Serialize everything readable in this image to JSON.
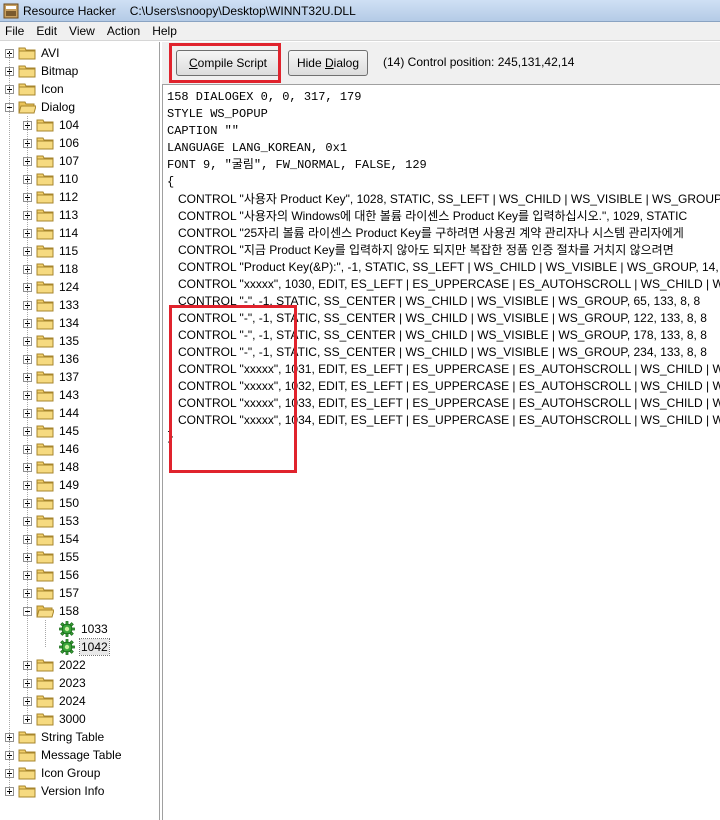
{
  "window": {
    "app_name": "Resource Hacker",
    "file_path": "C:\\Users\\snoopy\\Desktop\\WINNT32U.DLL"
  },
  "menu": [
    "File",
    "Edit",
    "View",
    "Action",
    "Help"
  ],
  "tree": {
    "top_level": [
      "AVI",
      "Bitmap",
      "Icon",
      "Dialog",
      "String Table",
      "Message Table",
      "Icon Group",
      "Version Info"
    ],
    "dialog_children": [
      "104",
      "106",
      "107",
      "110",
      "112",
      "113",
      "114",
      "115",
      "118",
      "124",
      "133",
      "134",
      "135",
      "136",
      "137",
      "143",
      "144",
      "145",
      "146",
      "148",
      "149",
      "150",
      "153",
      "154",
      "155",
      "156",
      "157",
      "158",
      "2022",
      "2023",
      "2024",
      "3000"
    ],
    "item_158_children": [
      "1033",
      "1042"
    ],
    "selected": "1042"
  },
  "toolbar": {
    "compile_label": "Compile Script",
    "hide_label": "Hide Dialog",
    "status": "(14)  Control position: 245,131,42,14"
  },
  "editor": {
    "header_lines": [
      "158 DIALOGEX 0, 0, 317, 179",
      "STYLE WS_POPUP",
      "CAPTION \"\"",
      "LANGUAGE LANG_KOREAN, 0x1",
      "FONT 9, \"굴림\", FW_NORMAL, FALSE, 129",
      "{"
    ],
    "control_lines": [
      "CONTROL \"사용자 Product Key\", 1028, STATIC, SS_LEFT | WS_CHILD | WS_VISIBLE | WS_GROUP, 14, 8",
      "CONTROL \"사용자의 Windows에 대한 볼륨 라이센스 Product Key를 입력하십시오.\", 1029, STATIC",
      "CONTROL \"25자리 볼륨 라이센스 Product Key를 구하려면 사용권 계약 관리자나 시스템 관리자에게",
      "CONTROL \"지금 Product Key를 입력하지 않아도 되지만 복잡한 정품 인증 절차를 거치지 않으려면",
      "CONTROL \"Product Key(&P):\", -1, STATIC, SS_LEFT | WS_CHILD | WS_VISIBLE | WS_GROUP, 14, 1",
      "CONTROL \"xxxxx\", 1030, EDIT, ES_LEFT | ES_UPPERCASE | ES_AUTOHSCROLL | WS_CHILD | WS",
      "CONTROL \"-\", -1, STATIC, SS_CENTER | WS_CHILD | WS_VISIBLE | WS_GROUP, 65, 133, 8, 8",
      "CONTROL \"-\", -1, STATIC, SS_CENTER | WS_CHILD | WS_VISIBLE | WS_GROUP, 122, 133, 8, 8",
      "CONTROL \"-\", -1, STATIC, SS_CENTER | WS_CHILD | WS_VISIBLE | WS_GROUP, 178, 133, 8, 8",
      "CONTROL \"-\", -1, STATIC, SS_CENTER | WS_CHILD | WS_VISIBLE | WS_GROUP, 234, 133, 8, 8",
      "CONTROL \"xxxxx\", 1031, EDIT, ES_LEFT | ES_UPPERCASE | ES_AUTOHSCROLL | WS_CHILD | WS",
      "CONTROL \"xxxxx\", 1032, EDIT, ES_LEFT | ES_UPPERCASE | ES_AUTOHSCROLL | WS_CHILD | WS",
      "CONTROL \"xxxxx\", 1033, EDIT, ES_LEFT | ES_UPPERCASE | ES_AUTOHSCROLL | WS_CHILD | WS",
      "CONTROL \"xxxxx\", 1034, EDIT, ES_LEFT | ES_UPPERCASE | ES_AUTOHSCROLL | WS_CHILD | WS"
    ],
    "closing": "}"
  },
  "colors": {
    "highlight": "#e0232d",
    "folder": "#f2d06b",
    "gear": "#3aa53a"
  }
}
